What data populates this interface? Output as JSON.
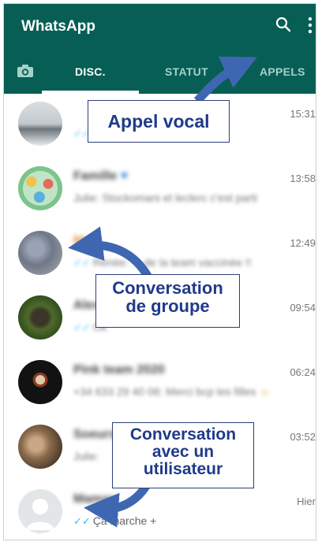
{
  "header": {
    "title": "WhatsApp",
    "icons": [
      "search-icon",
      "more-vert-icon"
    ]
  },
  "tabs": [
    {
      "label": "DISC.",
      "active": true
    },
    {
      "label": "STATUT",
      "active": false
    },
    {
      "label": "APPELS",
      "active": false
    }
  ],
  "chats": [
    {
      "name": "",
      "preview": "",
      "time": "15:31",
      "ticks": "✓✓"
    },
    {
      "name": "Famille",
      "preview": "Julie: Stockomani et leclerc c'est parti",
      "time": "13:58",
      "ticks": ""
    },
    {
      "name": "Ma",
      "preview": "Renée: ... de la team vaccinée !!",
      "time": "12:49",
      "ticks": "✓✓"
    },
    {
      "name": "Alex",
      "preview": "Ok",
      "time": "09:54",
      "ticks": "✓✓"
    },
    {
      "name": "Pink team 2020",
      "preview": "+34 633 29 40 06: Merci bcp les filles",
      "time": "06:24",
      "ticks": ""
    },
    {
      "name": "Soeurs",
      "preview": "Julie:",
      "time": "03:52",
      "ticks": ""
    },
    {
      "name": "Maman",
      "preview": "Ça marche +",
      "time": "Hier",
      "ticks": "✓✓"
    }
  ],
  "annotations": {
    "appel_vocal": "Appel vocal",
    "conv_groupe_1": "Conversation",
    "conv_groupe_2": "de groupe",
    "conv_user_1": "Conversation",
    "conv_user_2": "avec un",
    "conv_user_3": "utilisateur"
  },
  "colors": {
    "appbar": "#075E54",
    "ticks": "#34B7F1",
    "annotation": "#1f3a8a",
    "arrow": "#3f67b1"
  }
}
